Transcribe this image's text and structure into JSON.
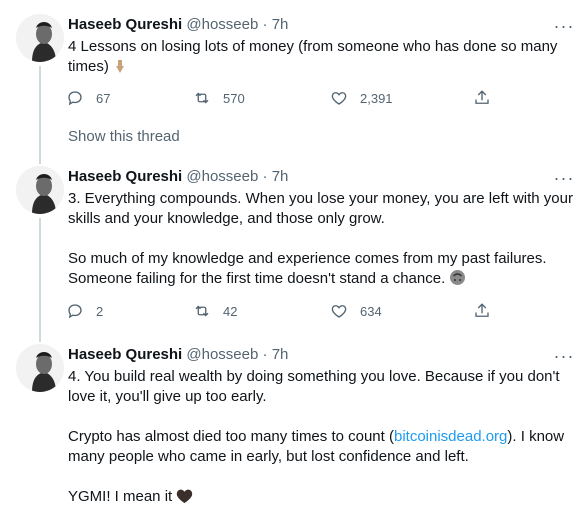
{
  "tweets": [
    {
      "name": "Haseeb Qureshi",
      "handle": "@hosseeb",
      "sep": "·",
      "time": "7h",
      "more": "···",
      "lines": [
        "4 Lessons on losing lots of money (from someone who has done so many",
        "times)"
      ],
      "emoji": "point-down-icon",
      "replies": "67",
      "retweets": "570",
      "likes": "2,391"
    },
    {
      "name": "Haseeb Qureshi",
      "handle": "@hosseeb",
      "sep": "·",
      "time": "7h",
      "more": "···",
      "para1": [
        "3. Everything compounds. When you lose your money, you are left with your",
        "skills and your knowledge, and those only grow."
      ],
      "para2": [
        "So much of my knowledge and experience comes from my past failures.",
        "Someone failing for the first time doesn't stand a chance."
      ],
      "emoji": "upside-down-face-icon",
      "replies": "2",
      "retweets": "42",
      "likes": "634"
    },
    {
      "name": "Haseeb Qureshi",
      "handle": "@hosseeb",
      "sep": "·",
      "time": "7h",
      "more": "···",
      "para1": [
        "4. You build real wealth by doing something you love. Because if you don't",
        "love it, you'll give up too early."
      ],
      "para2_prefix": "Crypto has almost died too many times to count (",
      "para2_link": "bitcoinisdead.org",
      "para2_suffix": "). I know",
      "para2_line2": "many people who came in early, but lost confidence and left.",
      "para3": "YGMI! I mean it",
      "emoji": "black-heart-icon"
    }
  ],
  "show_thread": "Show this thread",
  "colors": {
    "text": "#0f1419",
    "muted": "#536471",
    "link": "#1d9bf0",
    "line": "#cfd9de"
  }
}
